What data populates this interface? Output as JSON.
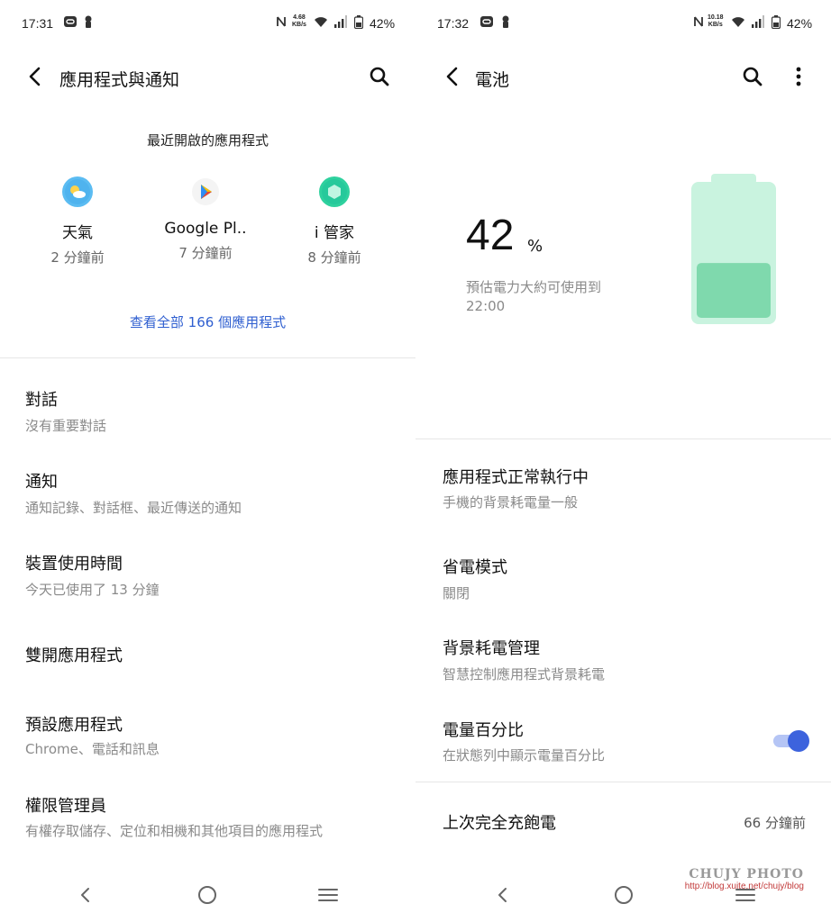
{
  "left": {
    "status": {
      "time": "17:31",
      "net_speed_value": "4.68",
      "net_speed_unit": "KB/s",
      "battery": "42%"
    },
    "title": "應用程式與通知",
    "recent_title": "最近開啟的應用程式",
    "recent_apps": [
      {
        "name": "天氣",
        "time": "2 分鐘前",
        "icon": "weather-icon"
      },
      {
        "name": "Google Pl..",
        "time": "7 分鐘前",
        "icon": "google-play-icon"
      },
      {
        "name": "i 管家",
        "time": "8 分鐘前",
        "icon": "i-manager-icon"
      }
    ],
    "see_all": "查看全部 166 個應用程式",
    "items": [
      {
        "title": "對話",
        "subtitle": "沒有重要對話"
      },
      {
        "title": "通知",
        "subtitle": "通知記錄、對話框、最近傳送的通知"
      },
      {
        "title": "裝置使用時間",
        "subtitle": "今天已使用了 13 分鐘"
      },
      {
        "title": "雙開應用程式",
        "subtitle": ""
      },
      {
        "title": "預設應用程式",
        "subtitle": "Chrome、電話和訊息"
      },
      {
        "title": "權限管理員",
        "subtitle": "有權存取儲存、定位和相機和其他項目的應用程式"
      }
    ]
  },
  "right": {
    "status": {
      "time": "17:32",
      "net_speed_value": "10.18",
      "net_speed_unit": "KB/s",
      "battery": "42%"
    },
    "title": "電池",
    "battery_level": "42",
    "battery_unit": "%",
    "battery_fraction": 0.42,
    "estimate_line1": "預估電力大約可使用到",
    "estimate_line2": "22:00",
    "items": [
      {
        "title": "應用程式正常執行中",
        "subtitle": "手機的背景耗電量一般"
      },
      {
        "title": "省電模式",
        "subtitle": "關閉"
      },
      {
        "title": "背景耗電管理",
        "subtitle": "智慧控制應用程式背景耗電"
      },
      {
        "title": "電量百分比",
        "subtitle": "在狀態列中顯示電量百分比",
        "toggle_on": true
      }
    ],
    "last_full_charge": {
      "title": "上次完全充飽電",
      "value": "66 分鐘前"
    }
  },
  "watermark": {
    "logo": "CHUJY PHOTO",
    "url": "http://blog.xuite.net/chujy/blog"
  },
  "colors": {
    "accent": "#3d63dd",
    "link": "#2f5fd0",
    "battery_body": "#c9f3df",
    "battery_fill": "#7fd9ad"
  }
}
